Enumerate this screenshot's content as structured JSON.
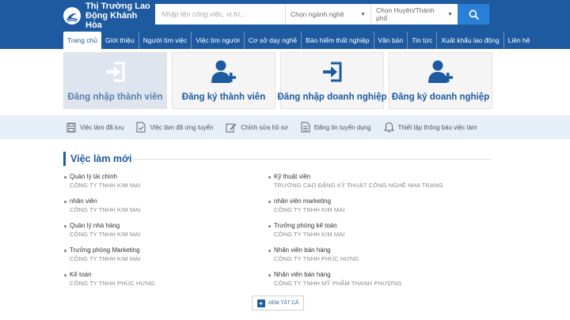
{
  "header": {
    "brand_line1": "Thị Trường Lao",
    "brand_line2": "Động Khánh Hòa",
    "search_placeholder": "Nhập tên công việc, vị trí...",
    "industry_select": "Chọn ngành nghề",
    "district_select": "Chọn Huyện/Thành phố",
    "search_icon": "search-icon",
    "colors": {
      "primary": "#1e5aa0",
      "search_button": "#2a7fd6"
    }
  },
  "nav": {
    "items": [
      {
        "label": "Trang chủ",
        "active": true
      },
      {
        "label": "Giới thiệu"
      },
      {
        "label": "Người tìm việc"
      },
      {
        "label": "Việc tìm người"
      },
      {
        "label": "Cơ sở dạy nghề"
      },
      {
        "label": "Bảo hiểm thất nghiệp"
      },
      {
        "label": "Văn bản"
      },
      {
        "label": "Tin tức"
      },
      {
        "label": "Xuất khẩu lao động"
      },
      {
        "label": "Liên hệ"
      }
    ]
  },
  "tiles": [
    {
      "label": "Đăng nhập thành viên",
      "icon": "login-icon",
      "active": true
    },
    {
      "label": "Đăng ký thành viên",
      "icon": "add-user-icon"
    },
    {
      "label": "Đăng nhập doanh nghiệp",
      "icon": "login-icon"
    },
    {
      "label": "Đăng ký doanh nghiệp",
      "icon": "add-user-icon"
    }
  ],
  "quick_links": [
    {
      "label": "Việc làm đã lưu",
      "icon": "save-disk-icon"
    },
    {
      "label": "Việc làm đã ứng tuyển",
      "icon": "document-check-icon"
    },
    {
      "label": "Chỉnh sửa hồ sơ",
      "icon": "edit-icon"
    },
    {
      "label": "Đăng tin tuyển dụng",
      "icon": "document-icon"
    },
    {
      "label": "Thiết lập thông báo việc làm",
      "icon": "bell-icon"
    }
  ],
  "jobs_section": {
    "title": "Việc làm mới",
    "left": [
      {
        "title": "Quản lý tài chính",
        "company": "CÔNG TY TNHH KIM MAI"
      },
      {
        "title": "nhân viên",
        "company": "CÔNG TY TNHH KIM MAI"
      },
      {
        "title": "Quản lý nhà hàng",
        "company": "CÔNG TY TNHH KIM MAI"
      },
      {
        "title": "Trưởng phòng Marketing",
        "company": "CÔNG TY TNHH KIM MAI"
      },
      {
        "title": "Kế toán",
        "company": "CÔNG TY TNHH PHÚC HƯNG"
      }
    ],
    "right": [
      {
        "title": "Kỹ thuật viên",
        "company": "TRƯỜNG CAO ĐẲNG KỸ THUẬT CÔNG NGHỆ NHA TRANG"
      },
      {
        "title": "nhân viên marketing",
        "company": "CÔNG TY TNHH KIM MAI"
      },
      {
        "title": "Trưởng phòng kế toán",
        "company": "CÔNG TY TNHH KIM MAI"
      },
      {
        "title": "Nhân viên bán hàng",
        "company": "CÔNG TY TNHH PHÚC HƯNG"
      },
      {
        "title": "Nhân viên bán hàng",
        "company": "CÔNG TY TNHH MỸ PHẨM THANH PHƯỢNG"
      }
    ],
    "view_all": "XEM TẤT CẢ"
  }
}
